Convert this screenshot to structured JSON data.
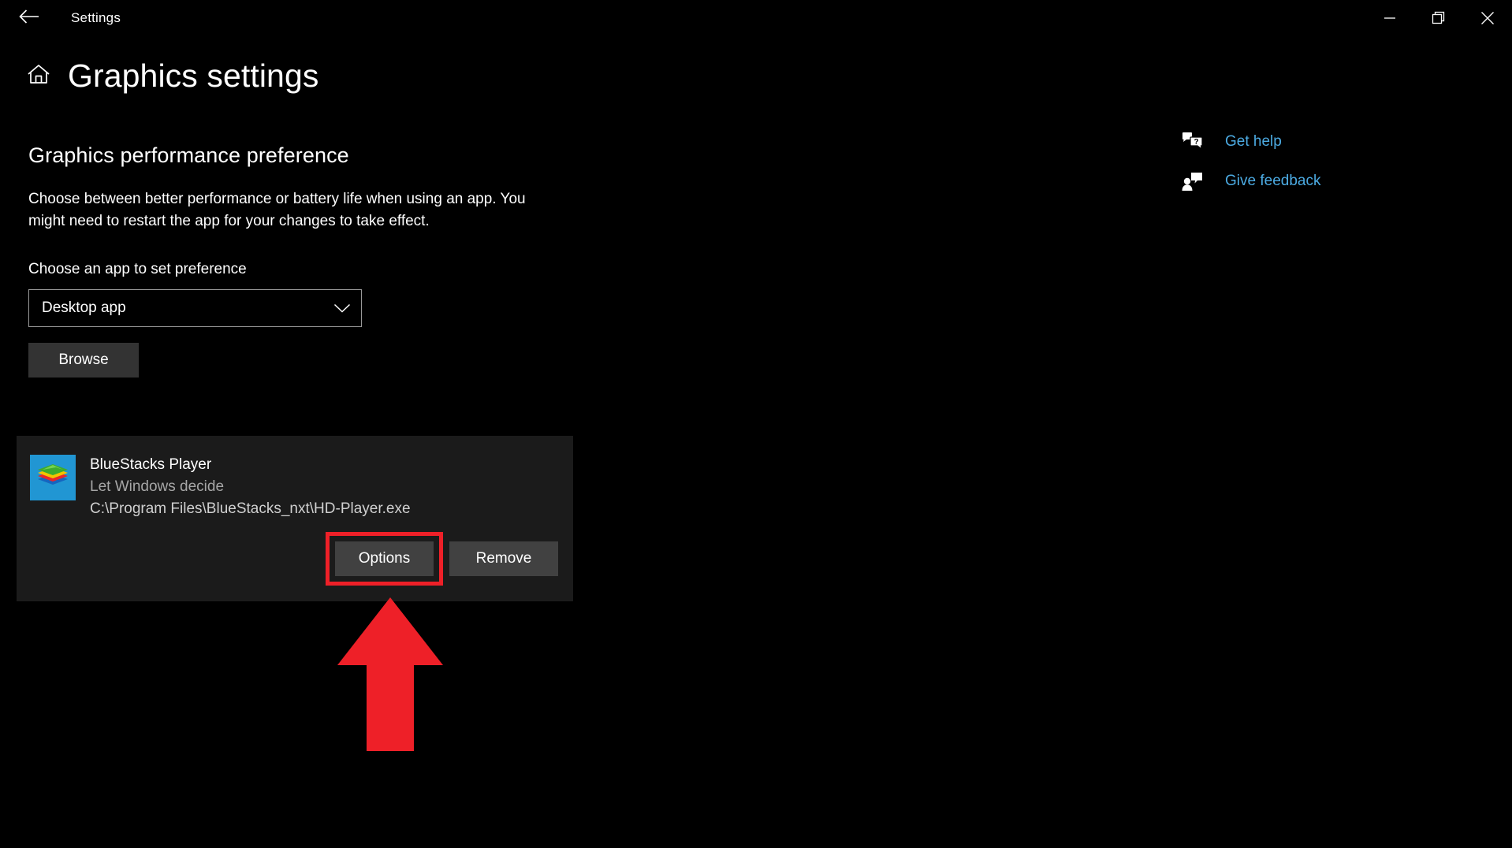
{
  "window": {
    "title": "Settings",
    "back_icon": "back-arrow-icon",
    "controls": [
      {
        "name": "minimize-button",
        "icon": "minimize-icon",
        "label": "Minimize"
      },
      {
        "name": "maximize-button",
        "icon": "restore-icon",
        "label": "Restore"
      },
      {
        "name": "close-button",
        "icon": "close-icon",
        "label": "Close"
      }
    ]
  },
  "header": {
    "home_icon": "home-icon",
    "title": "Graphics settings"
  },
  "main": {
    "section_title": "Graphics performance preference",
    "description": "Choose between better performance or battery life when using an app. You might need to restart the app for your changes to take effect.",
    "field_label": "Choose an app to set preference",
    "dropdown": {
      "value": "Desktop app",
      "chevron_icon": "chevron-down-icon",
      "options": [
        "Desktop app"
      ]
    },
    "browse_label": "Browse"
  },
  "app_card": {
    "icon": "bluestacks-app-icon",
    "name": "BlueStacks Player",
    "preference": "Let Windows decide",
    "path": "C:\\Program Files\\BlueStacks_nxt\\HD-Player.exe",
    "options_label": "Options",
    "remove_label": "Remove"
  },
  "help": {
    "items": [
      {
        "icon": "get-help-icon",
        "label": "Get help"
      },
      {
        "icon": "give-feedback-icon",
        "label": "Give feedback"
      }
    ]
  },
  "annotation": {
    "arrow_icon": "red-up-arrow-annotation",
    "highlight_target": "Options",
    "color": "#ee2028"
  },
  "colors": {
    "background": "#000000",
    "card_background": "#1b1b1b",
    "button_background": "#414141",
    "browse_background": "#333333",
    "link": "#4cabe3",
    "muted_text": "#a6a6a6",
    "accent_red": "#ee2028"
  }
}
